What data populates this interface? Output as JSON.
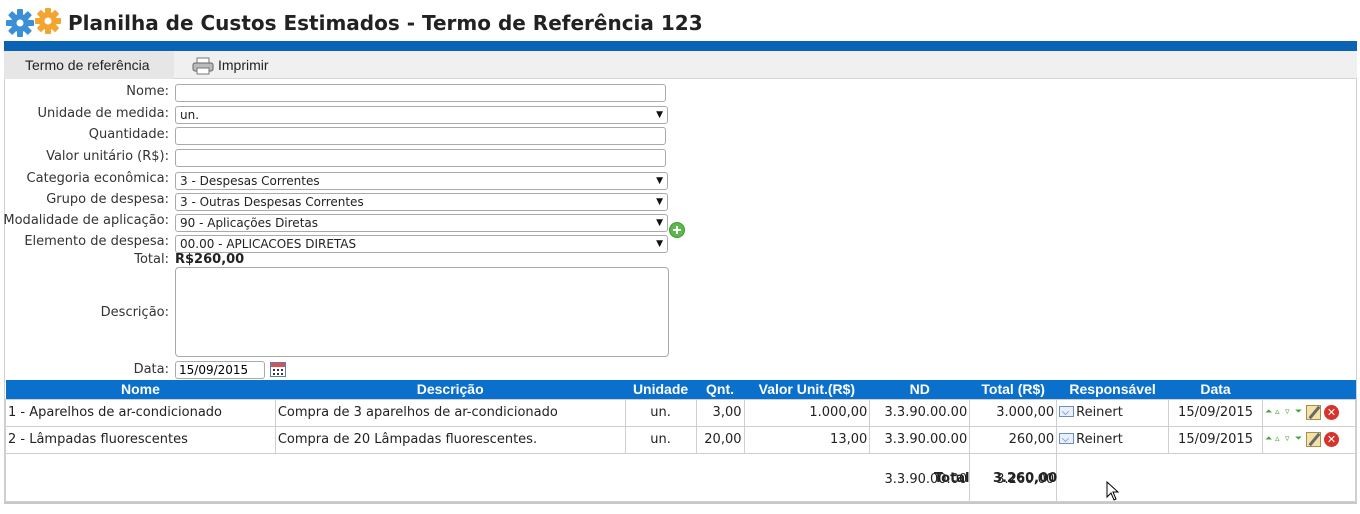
{
  "page": {
    "title": "Planilha de Custos Estimados - Termo de Referência 123"
  },
  "menu": {
    "termo_label": "Termo de referência",
    "imprimir_label": "Imprimir"
  },
  "form": {
    "nome_label": "Nome:",
    "nome_value": "",
    "unidade_label": "Unidade de medida:",
    "unidade_value": "un.",
    "quantidade_label": "Quantidade:",
    "quantidade_value": "",
    "valor_label": "Valor unitário (R$):",
    "valor_value": "",
    "categoria_label": "Categoria econômica:",
    "categoria_value": "3 - Despesas Correntes",
    "grupo_label": "Grupo de despesa:",
    "grupo_value": "3 - Outras Despesas Correntes",
    "modalidade_label": "Modalidade de aplicação:",
    "modalidade_value": "90 - Aplicações Diretas",
    "elemento_label": "Elemento de despesa:",
    "elemento_value": "00.00 - APLICACOES DIRETAS",
    "total_label": "Total:",
    "total_value": "R$260,00",
    "descricao_label": "Descrição:",
    "data_label": "Data:",
    "data_value": "15/09/2015"
  },
  "table": {
    "headers": [
      "Nome",
      "Descrição",
      "Unidade",
      "Qnt.",
      "Valor Unit.(R$)",
      "ND",
      "Total (R$)",
      "Responsável",
      "Data"
    ],
    "rows": [
      {
        "nome": "1 - Aparelhos de ar-condicionado",
        "descricao": "Compra de 3 aparelhos de ar-condicionado",
        "unidade": "un.",
        "qnt": "3,00",
        "valor_unit": "1.000,00",
        "nd": "3.3.90.00.00",
        "total": "3.000,00",
        "responsavel": "Reinert",
        "data": "15/09/2015"
      },
      {
        "nome": "2 - Lâmpadas fluorescentes",
        "descricao": "Compra de 20 Lâmpadas fluorescentes.",
        "unidade": "un.",
        "qnt": "20,00",
        "valor_unit": "13,00",
        "nd": "3.3.90.00.00",
        "total": "260,00",
        "responsavel": "Reinert",
        "data": "15/09/2015"
      }
    ],
    "summary_nd": "3.3.90.00.00",
    "summary_nd_total": "3.260,00",
    "grand_total_label": "Total",
    "grand_total_value": "3.260,00"
  },
  "colors": {
    "accent": "#0b63b4",
    "header": "#0b6fcc",
    "add": "#5bb84a",
    "delete": "#d9322a"
  },
  "icons": [
    "gears-logo-icon",
    "printer-icon",
    "chevron-down-icon",
    "add-icon",
    "calendar-icon",
    "responsible-icon",
    "move-top-icon",
    "move-up-icon",
    "move-down-icon",
    "move-bottom-icon",
    "edit-icon",
    "delete-icon",
    "mouse-cursor-icon"
  ]
}
